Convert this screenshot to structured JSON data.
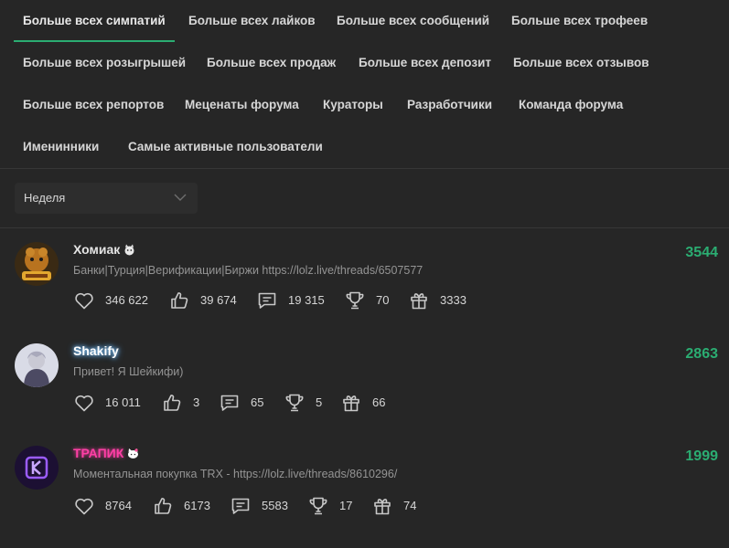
{
  "tabs": [
    "Больше всех симпатий",
    "Больше всех лайков",
    "Больше всех сообщений",
    "Больше всех трофеев",
    "Больше всех розыгрышей",
    "Больше всех продаж",
    "Больше всех депозит",
    "Больше всех отзывов",
    "Больше всех репортов",
    "Меценаты форума",
    "Кураторы",
    "Разработчики",
    "Команда форума",
    "Именинники",
    "Самые активные пользователи"
  ],
  "active_tab": "Больше всех симпатий",
  "period": {
    "selected": "Неделя"
  },
  "colors": {
    "accent": "#2bad72",
    "background": "#262626",
    "muted_text": "#949494"
  },
  "users": [
    {
      "name": "Хомиак",
      "status": "Банки|Турция|Верификации|Биржи https://lolz.live/threads/6507577",
      "score": "3544",
      "stats": {
        "sympathies": "346 622",
        "likes": "39 674",
        "messages": "19 315",
        "trophies": "70",
        "gifts": "3333"
      }
    },
    {
      "name": "Shakify",
      "status": "Привет! Я Шейкифи)",
      "score": "2863",
      "stats": {
        "sympathies": "16 011",
        "likes": "3",
        "messages": "65",
        "trophies": "5",
        "gifts": "66"
      }
    },
    {
      "name": "ТРАПИК",
      "status": "Моментальная покупка TRX - https://lolz.live/threads/8610296/",
      "score": "1999",
      "stats": {
        "sympathies": "8764",
        "likes": "6173",
        "messages": "5583",
        "trophies": "17",
        "gifts": "74"
      }
    }
  ],
  "icons": [
    "heart-icon",
    "thumbs-up-icon",
    "message-icon",
    "trophy-icon",
    "gift-icon",
    "chevron-down-icon"
  ]
}
